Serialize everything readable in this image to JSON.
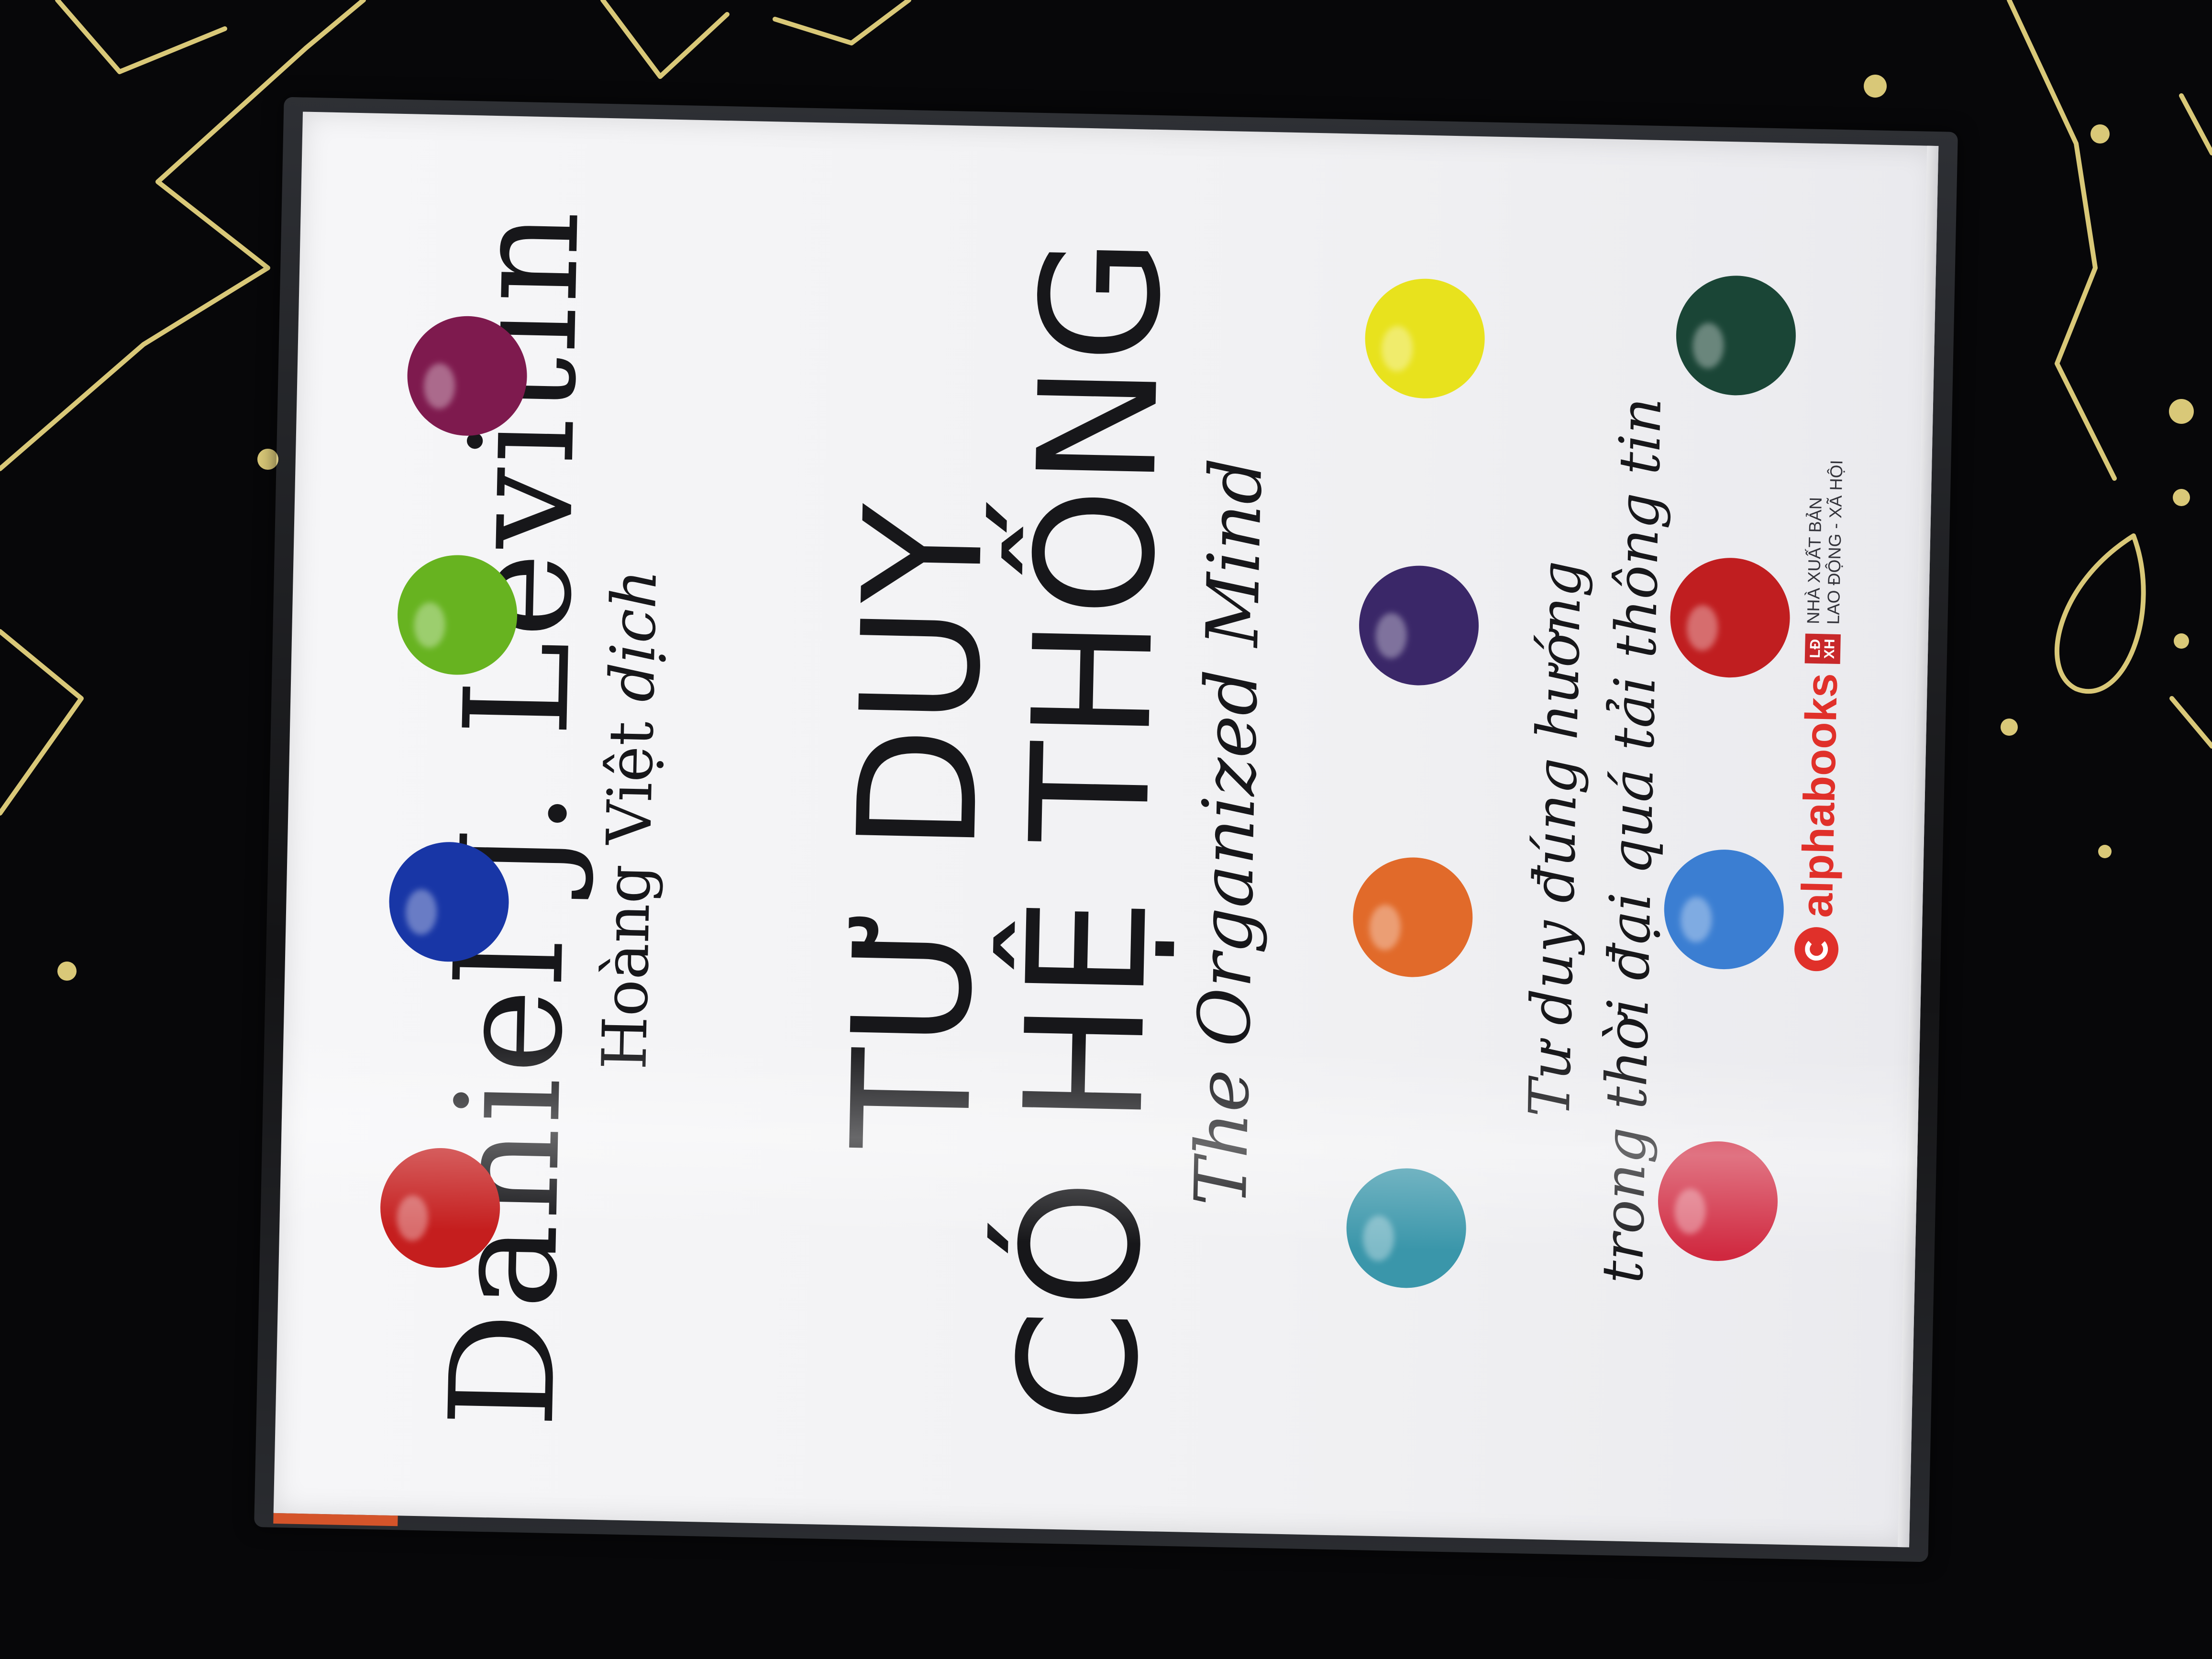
{
  "cover": {
    "author": "Daniel J. Levitin",
    "translator_name": "Hoàng Việt",
    "translator_role": "dịch",
    "title_line1": "TƯ DUY",
    "title_line2": "CÓ HỆ THỐNG",
    "subtitle_en": "The Organized Mind",
    "tagline_line1": "Tư duy đúng hướng",
    "tagline_line2": "trong thời đại quá tải thông tin"
  },
  "publisher": {
    "brand": "alphabooks",
    "house_line1": "NHÀ XUẤT BẢN",
    "house_line2": "LAO ĐỘNG - XÃ HỘI",
    "house_badge": "LĐ XH"
  },
  "colors": {
    "cover": "#f3f3f5",
    "text": "#17171a",
    "background": "#070709",
    "stars": "#d9c878",
    "dots": [
      "#7e1a4e",
      "#67b320",
      "#1836a6",
      "#c51e1e",
      "#e8e21d",
      "#3a2768",
      "#e16a2a",
      "#3a96aa",
      "#1a4536",
      "#c01e20",
      "#3b7ed2",
      "#d0283f"
    ]
  },
  "icons": [
    "star-pattern",
    "alphabooks-logo-icon",
    "publisher-badge-icon"
  ]
}
